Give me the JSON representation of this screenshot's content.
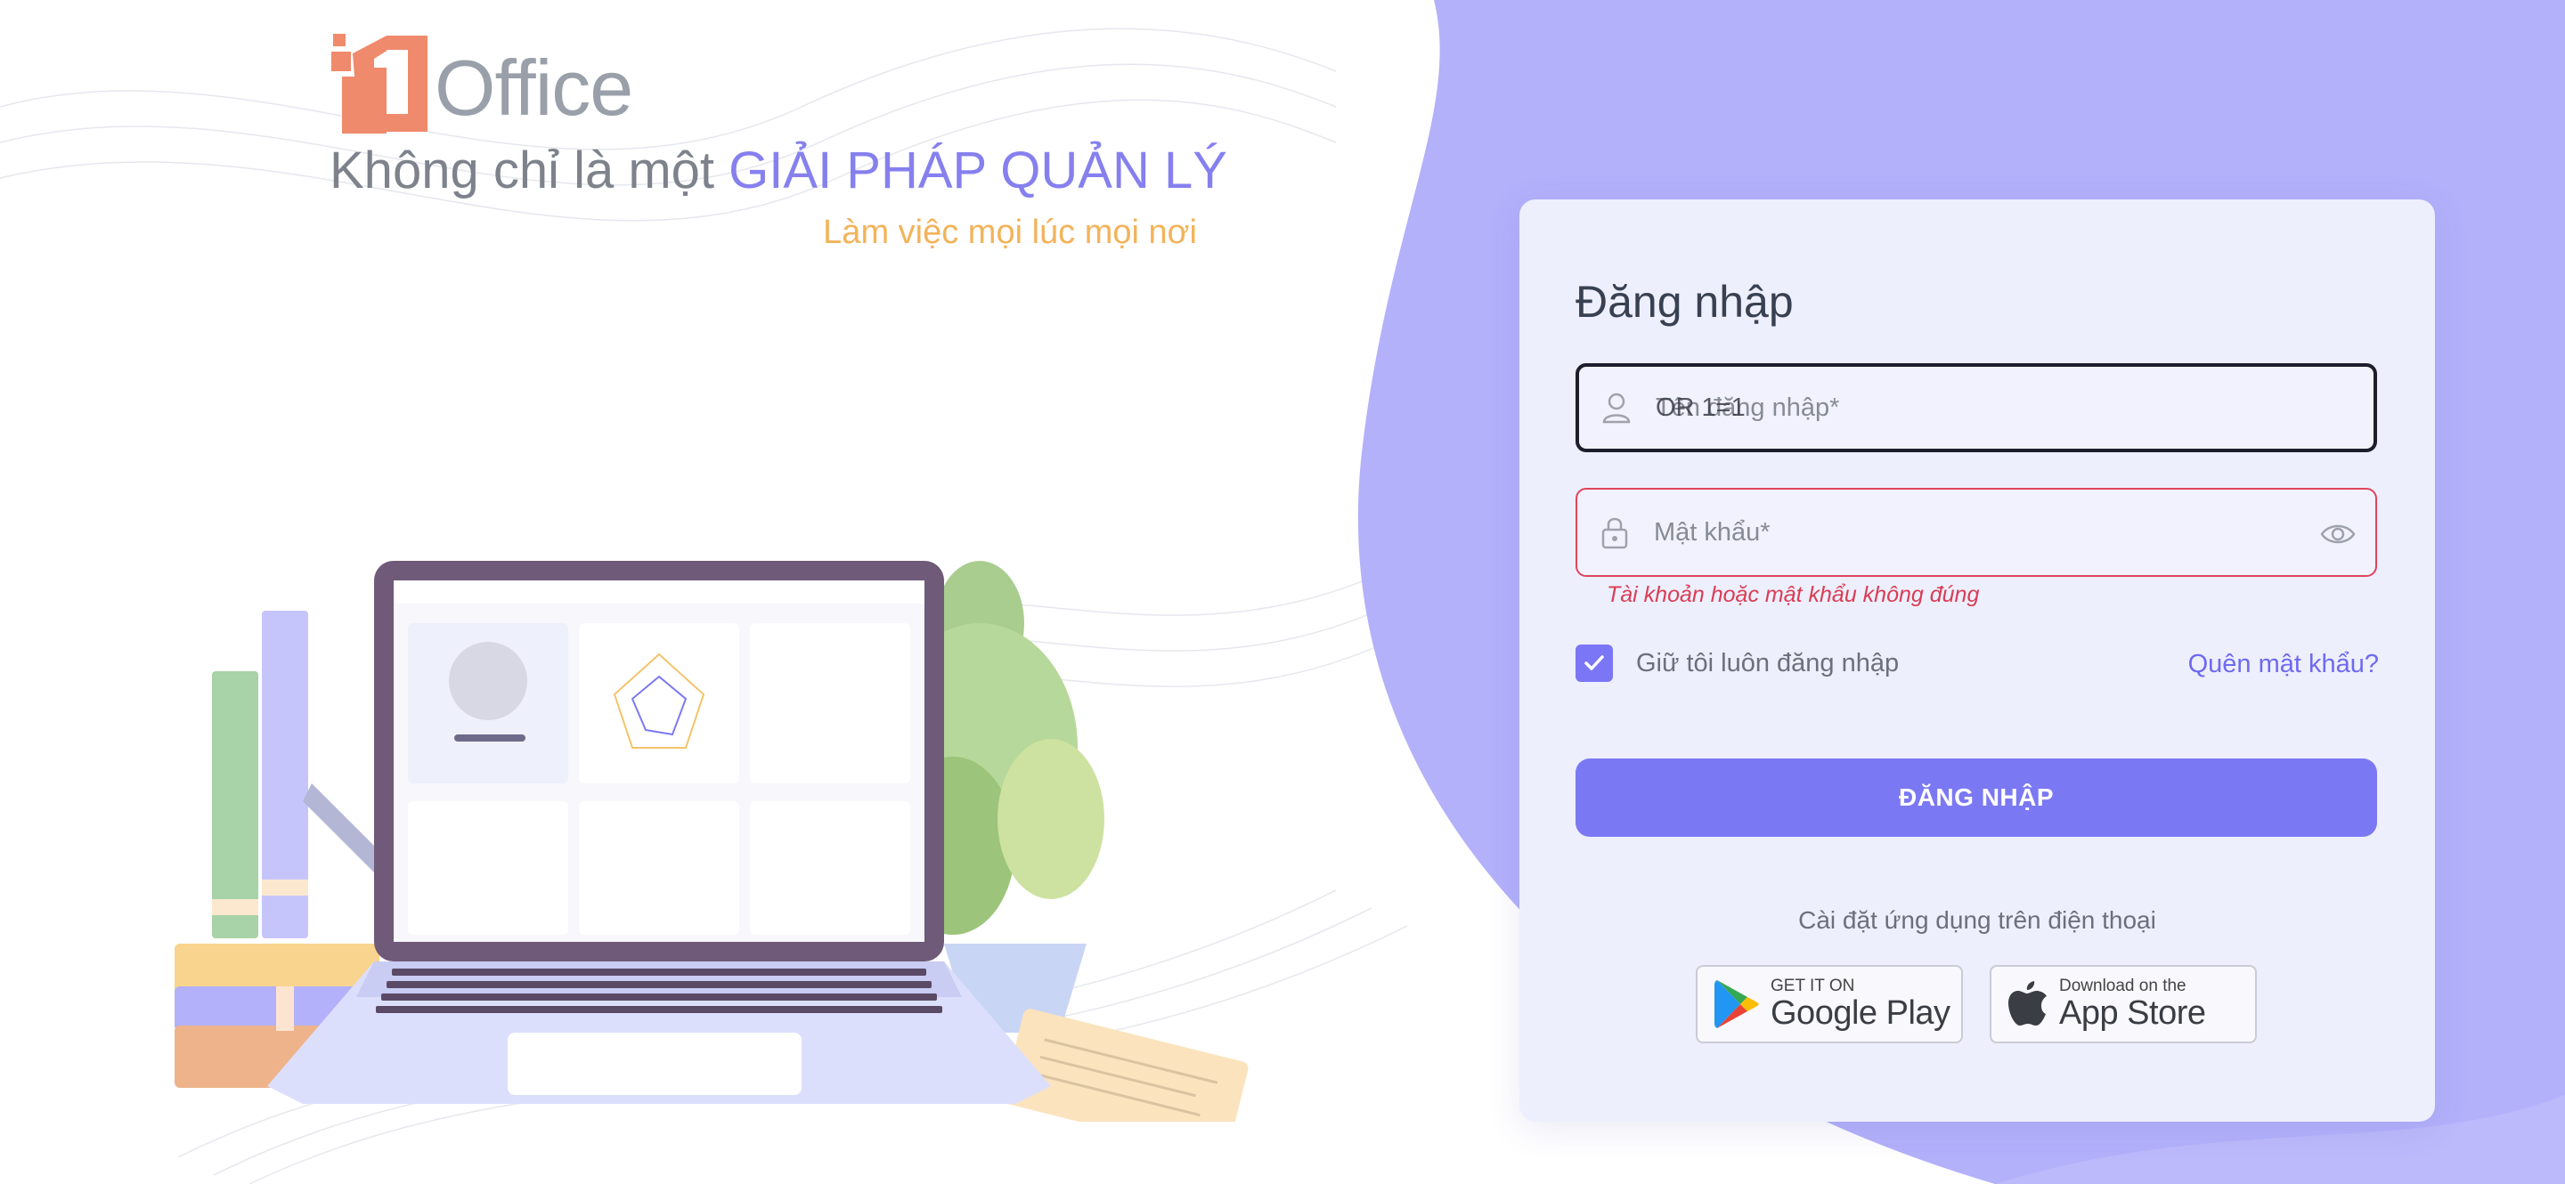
{
  "brand": {
    "logo_text": "Office",
    "tagline_prefix": "Không chỉ là một",
    "tagline_accent": "GIẢI PHÁP QUẢN LÝ",
    "subtagline": "Làm việc mọi lúc mọi nơi"
  },
  "colors": {
    "accent": "#7b78f4",
    "panel_background": "#b3b1fa",
    "error": "#d93d55",
    "subtagline": "#f3b35a",
    "logo_orange": "#ef8a6c"
  },
  "login": {
    "title": "Đăng nhập",
    "username": {
      "placeholder": "Tên đăng nhập*",
      "value": "OR 1=1",
      "icon": "user-icon"
    },
    "password": {
      "placeholder": "Mật khẩu*",
      "value": "",
      "icon": "lock-icon",
      "toggle_icon": "eye-icon"
    },
    "error_message": "Tài khoản hoặc mật khẩu không đúng",
    "remember_label": "Giữ tôi luôn đăng nhập",
    "remember_checked": true,
    "forgot_link": "Quên mật khẩu?",
    "submit_label": "ĐĂNG NHẬP"
  },
  "mobile": {
    "install_text": "Cài đặt ứng dụng trên điện thoại",
    "google_play": {
      "small": "GET IT ON",
      "big": "Google Play",
      "icon": "google-play-icon"
    },
    "app_store": {
      "small": "Download on the",
      "big": "App Store",
      "icon": "apple-icon"
    }
  }
}
